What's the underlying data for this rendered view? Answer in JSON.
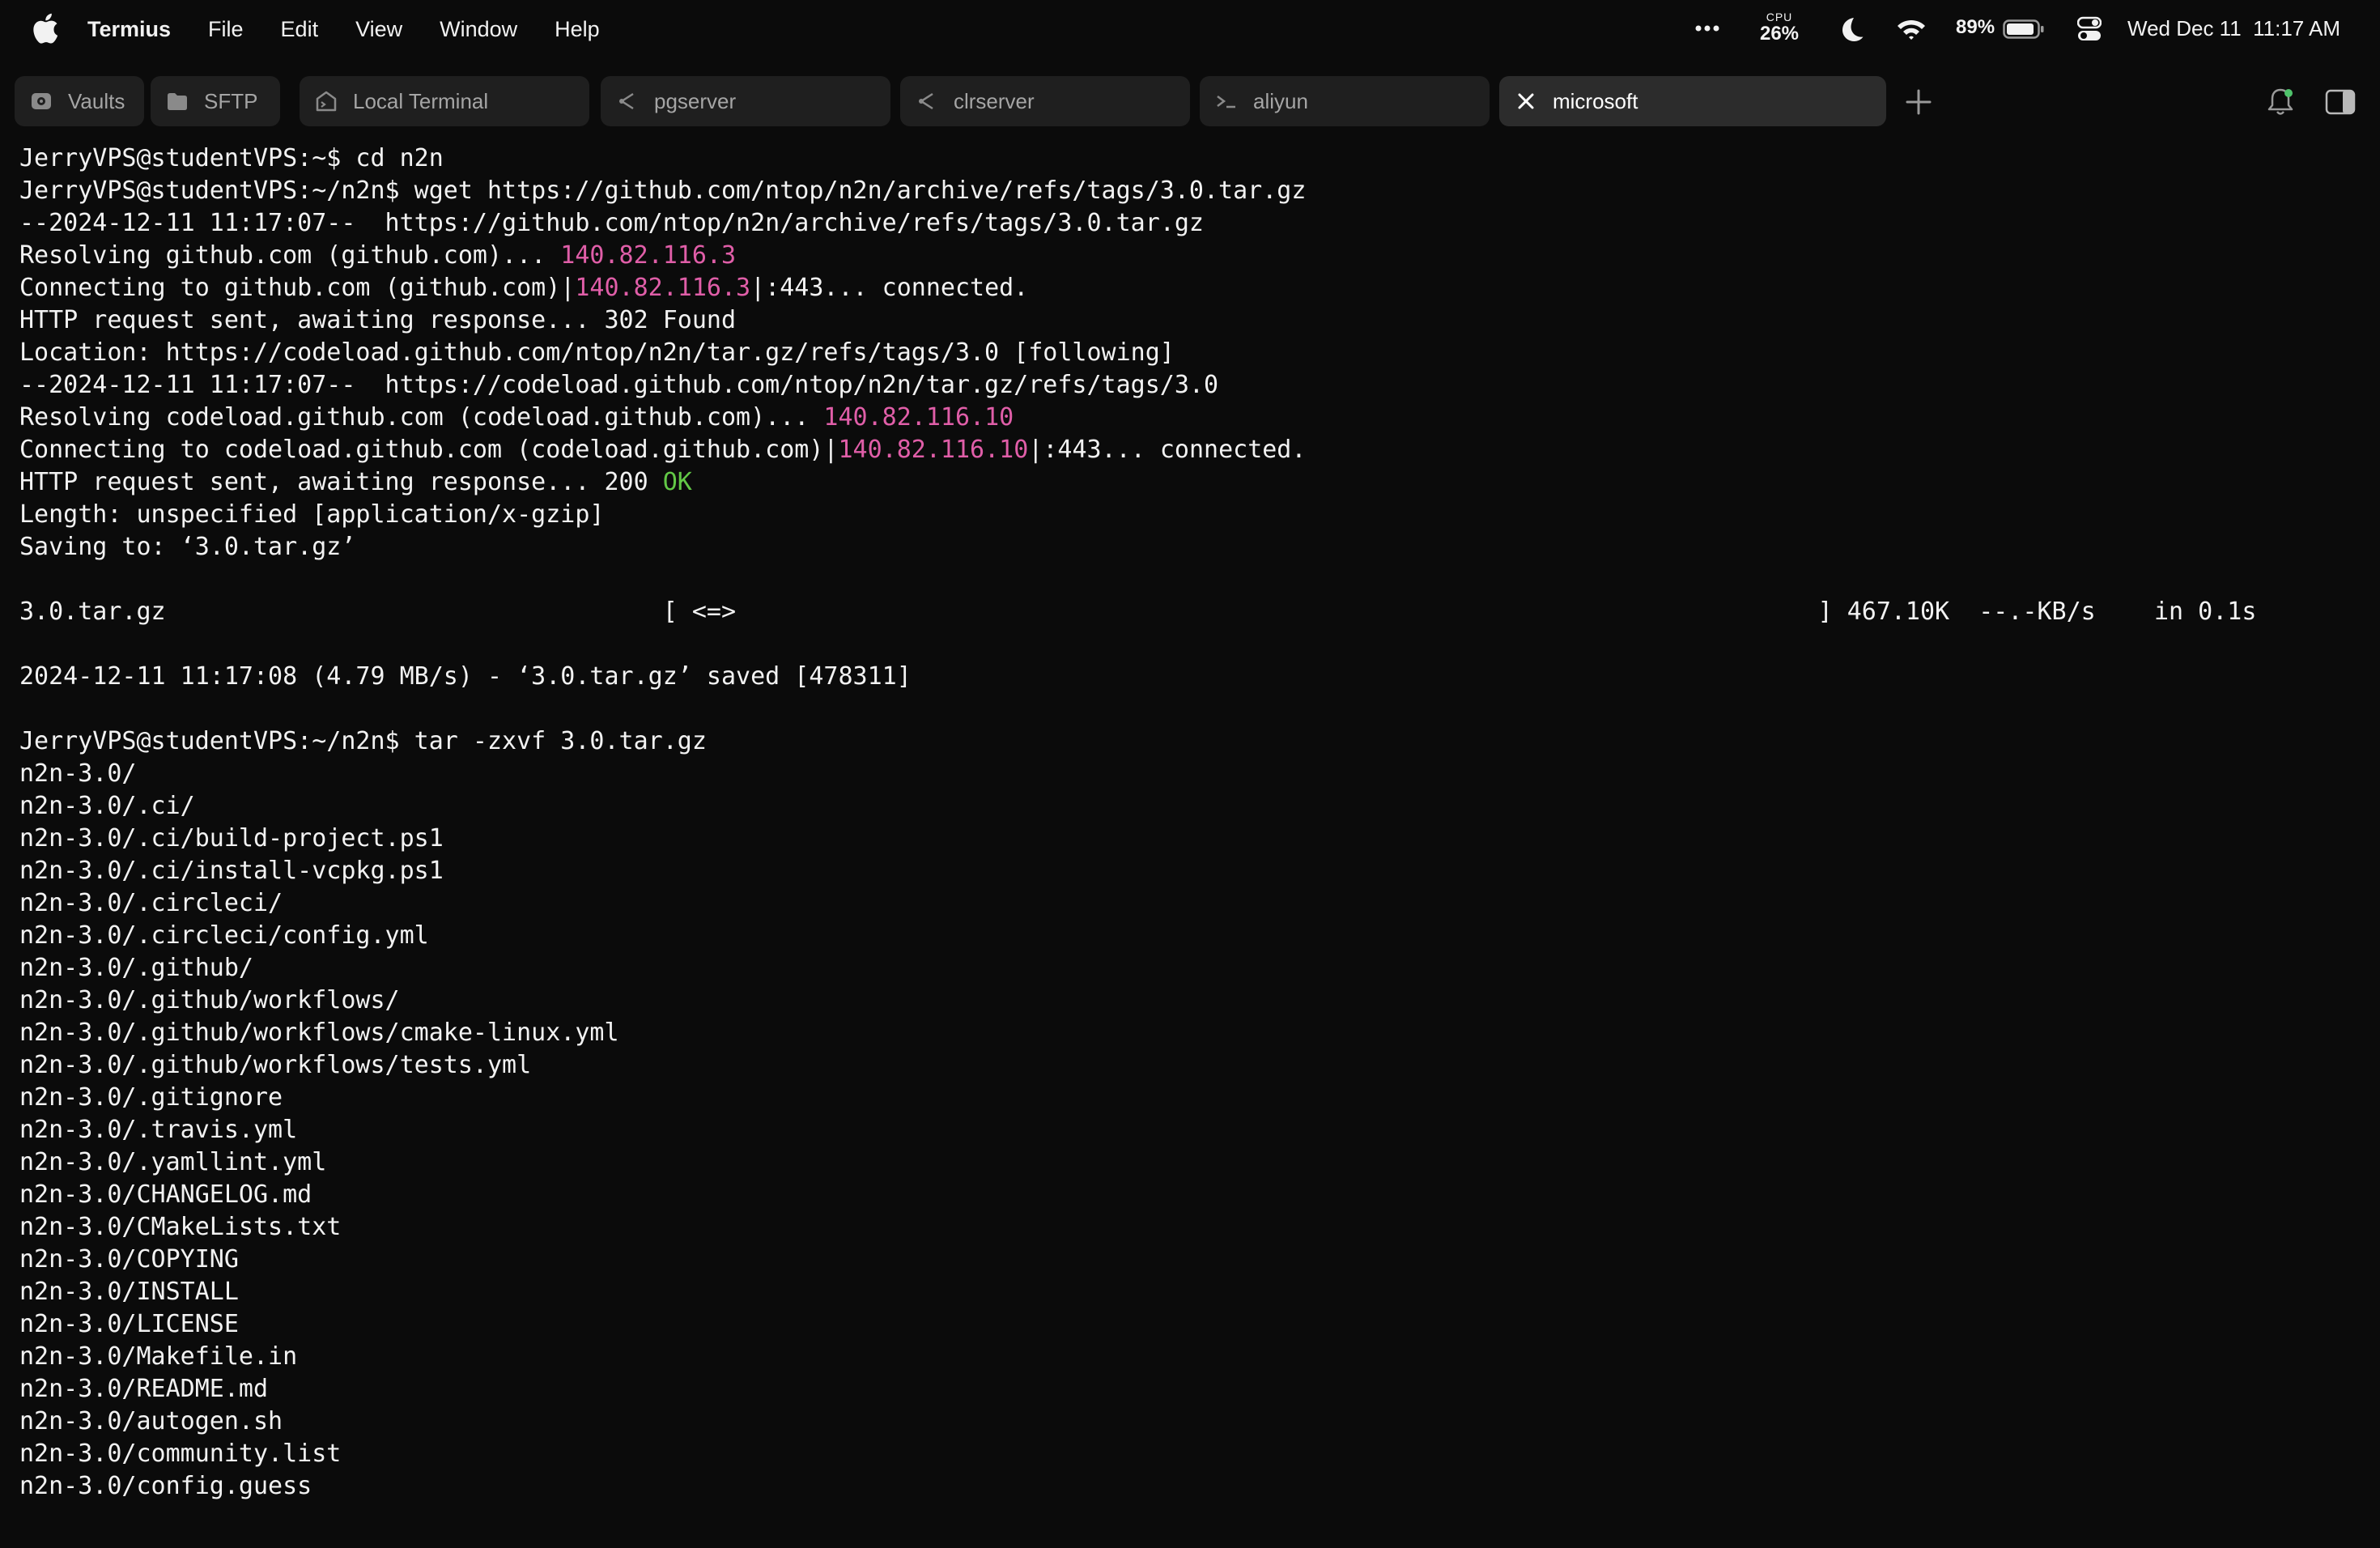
{
  "menubar": {
    "app_name": "Termius",
    "menus": [
      "File",
      "Edit",
      "View",
      "Window",
      "Help"
    ],
    "cpu_label": "CPU",
    "cpu_value": "26%",
    "battery": "89%",
    "datetime": "Wed Dec 11  11:17 AM"
  },
  "tabs": [
    {
      "label": "Vaults",
      "icon": "vault-icon",
      "active": false
    },
    {
      "label": "SFTP",
      "icon": "folder-icon",
      "active": false
    },
    {
      "label": "Local Terminal",
      "icon": "local-terminal-icon",
      "active": false
    },
    {
      "label": "pgserver",
      "icon": "host-icon",
      "active": false
    },
    {
      "label": "clrserver",
      "icon": "host-icon",
      "active": false
    },
    {
      "label": "aliyun",
      "icon": "prompt-icon",
      "active": false
    },
    {
      "label": "microsoft",
      "icon": "close-icon",
      "active": true
    }
  ],
  "colors": {
    "ip": "#e05ea8",
    "ok": "#62c846",
    "text": "#f2f2f2",
    "background": "#0b0b0b"
  },
  "terminal": {
    "lines": [
      [
        {
          "t": "JerryVPS@studentVPS:~$ cd n2n"
        }
      ],
      [
        {
          "t": "JerryVPS@studentVPS:~/n2n$ wget https://github.com/ntop/n2n/archive/refs/tags/3.0.tar.gz"
        }
      ],
      [
        {
          "t": "--2024-12-11 11:17:07--  https://github.com/ntop/n2n/archive/refs/tags/3.0.tar.gz"
        }
      ],
      [
        {
          "t": "Resolving github.com (github.com)... "
        },
        {
          "t": "140.82.116.3",
          "c": "ip"
        }
      ],
      [
        {
          "t": "Connecting to github.com (github.com)|"
        },
        {
          "t": "140.82.116.3",
          "c": "ip"
        },
        {
          "t": "|:443... connected."
        }
      ],
      [
        {
          "t": "HTTP request sent, awaiting response... 302 Found"
        }
      ],
      [
        {
          "t": "Location: https://codeload.github.com/ntop/n2n/tar.gz/refs/tags/3.0 [following]"
        }
      ],
      [
        {
          "t": "--2024-12-11 11:17:07--  https://codeload.github.com/ntop/n2n/tar.gz/refs/tags/3.0"
        }
      ],
      [
        {
          "t": "Resolving codeload.github.com (codeload.github.com)... "
        },
        {
          "t": "140.82.116.10",
          "c": "ip"
        }
      ],
      [
        {
          "t": "Connecting to codeload.github.com (codeload.github.com)|"
        },
        {
          "t": "140.82.116.10",
          "c": "ip"
        },
        {
          "t": "|:443... connected."
        }
      ],
      [
        {
          "t": "HTTP request sent, awaiting response... 200 "
        },
        {
          "t": "OK",
          "c": "ok"
        }
      ],
      [
        {
          "t": "Length: unspecified [application/x-gzip]"
        }
      ],
      [
        {
          "t": "Saving to: ‘3.0.tar.gz’"
        }
      ],
      [
        {
          "t": ""
        }
      ],
      [
        {
          "t": "3.0.tar.gz                                  [ <=>                                                                          ] 467.10K  --.-KB/s    in 0.1s"
        }
      ],
      [
        {
          "t": ""
        }
      ],
      [
        {
          "t": "2024-12-11 11:17:08 (4.79 MB/s) - ‘3.0.tar.gz’ saved [478311]"
        }
      ],
      [
        {
          "t": ""
        }
      ],
      [
        {
          "t": "JerryVPS@studentVPS:~/n2n$ tar -zxvf 3.0.tar.gz"
        }
      ],
      [
        {
          "t": "n2n-3.0/"
        }
      ],
      [
        {
          "t": "n2n-3.0/.ci/"
        }
      ],
      [
        {
          "t": "n2n-3.0/.ci/build-project.ps1"
        }
      ],
      [
        {
          "t": "n2n-3.0/.ci/install-vcpkg.ps1"
        }
      ],
      [
        {
          "t": "n2n-3.0/.circleci/"
        }
      ],
      [
        {
          "t": "n2n-3.0/.circleci/config.yml"
        }
      ],
      [
        {
          "t": "n2n-3.0/.github/"
        }
      ],
      [
        {
          "t": "n2n-3.0/.github/workflows/"
        }
      ],
      [
        {
          "t": "n2n-3.0/.github/workflows/cmake-linux.yml"
        }
      ],
      [
        {
          "t": "n2n-3.0/.github/workflows/tests.yml"
        }
      ],
      [
        {
          "t": "n2n-3.0/.gitignore"
        }
      ],
      [
        {
          "t": "n2n-3.0/.travis.yml"
        }
      ],
      [
        {
          "t": "n2n-3.0/.yamllint.yml"
        }
      ],
      [
        {
          "t": "n2n-3.0/CHANGELOG.md"
        }
      ],
      [
        {
          "t": "n2n-3.0/CMakeLists.txt"
        }
      ],
      [
        {
          "t": "n2n-3.0/COPYING"
        }
      ],
      [
        {
          "t": "n2n-3.0/INSTALL"
        }
      ],
      [
        {
          "t": "n2n-3.0/LICENSE"
        }
      ],
      [
        {
          "t": "n2n-3.0/Makefile.in"
        }
      ],
      [
        {
          "t": "n2n-3.0/README.md"
        }
      ],
      [
        {
          "t": "n2n-3.0/autogen.sh"
        }
      ],
      [
        {
          "t": "n2n-3.0/community.list"
        }
      ],
      [
        {
          "t": "n2n-3.0/config.guess"
        }
      ]
    ]
  }
}
